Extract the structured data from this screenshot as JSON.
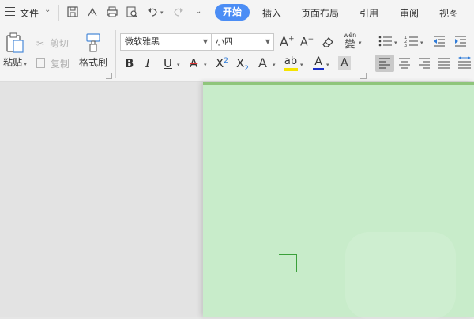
{
  "menu": {
    "file_label": "文件",
    "tabs": [
      "开始",
      "插入",
      "页面布局",
      "引用",
      "审阅",
      "视图"
    ],
    "active_tab": "开始"
  },
  "clipboard": {
    "paste_label": "粘贴",
    "cut_label": "剪切",
    "copy_label": "复制",
    "format_painter_label": "格式刷"
  },
  "font": {
    "family_value": "微软雅黑",
    "size_value": "小四",
    "grow_label": "A",
    "shrink_label": "A",
    "phonetic_top": "wén",
    "phonetic_char": "變",
    "bold": "B",
    "italic": "I",
    "underline": "U",
    "strike": "A",
    "sup": "X",
    "sub": "X",
    "sup_mark": "2",
    "sub_mark": "2",
    "text_effect": "A",
    "highlight": "ab",
    "font_color": "A",
    "char_shade": "A"
  },
  "colors": {
    "accent_tab": "#4b8df5",
    "page_bg": "#c8ecca",
    "page_top_border": "#8fc57b",
    "highlight_bar": "#f5e400",
    "font_color_bar": "#1a2ec8",
    "strike_red": "#d33"
  }
}
